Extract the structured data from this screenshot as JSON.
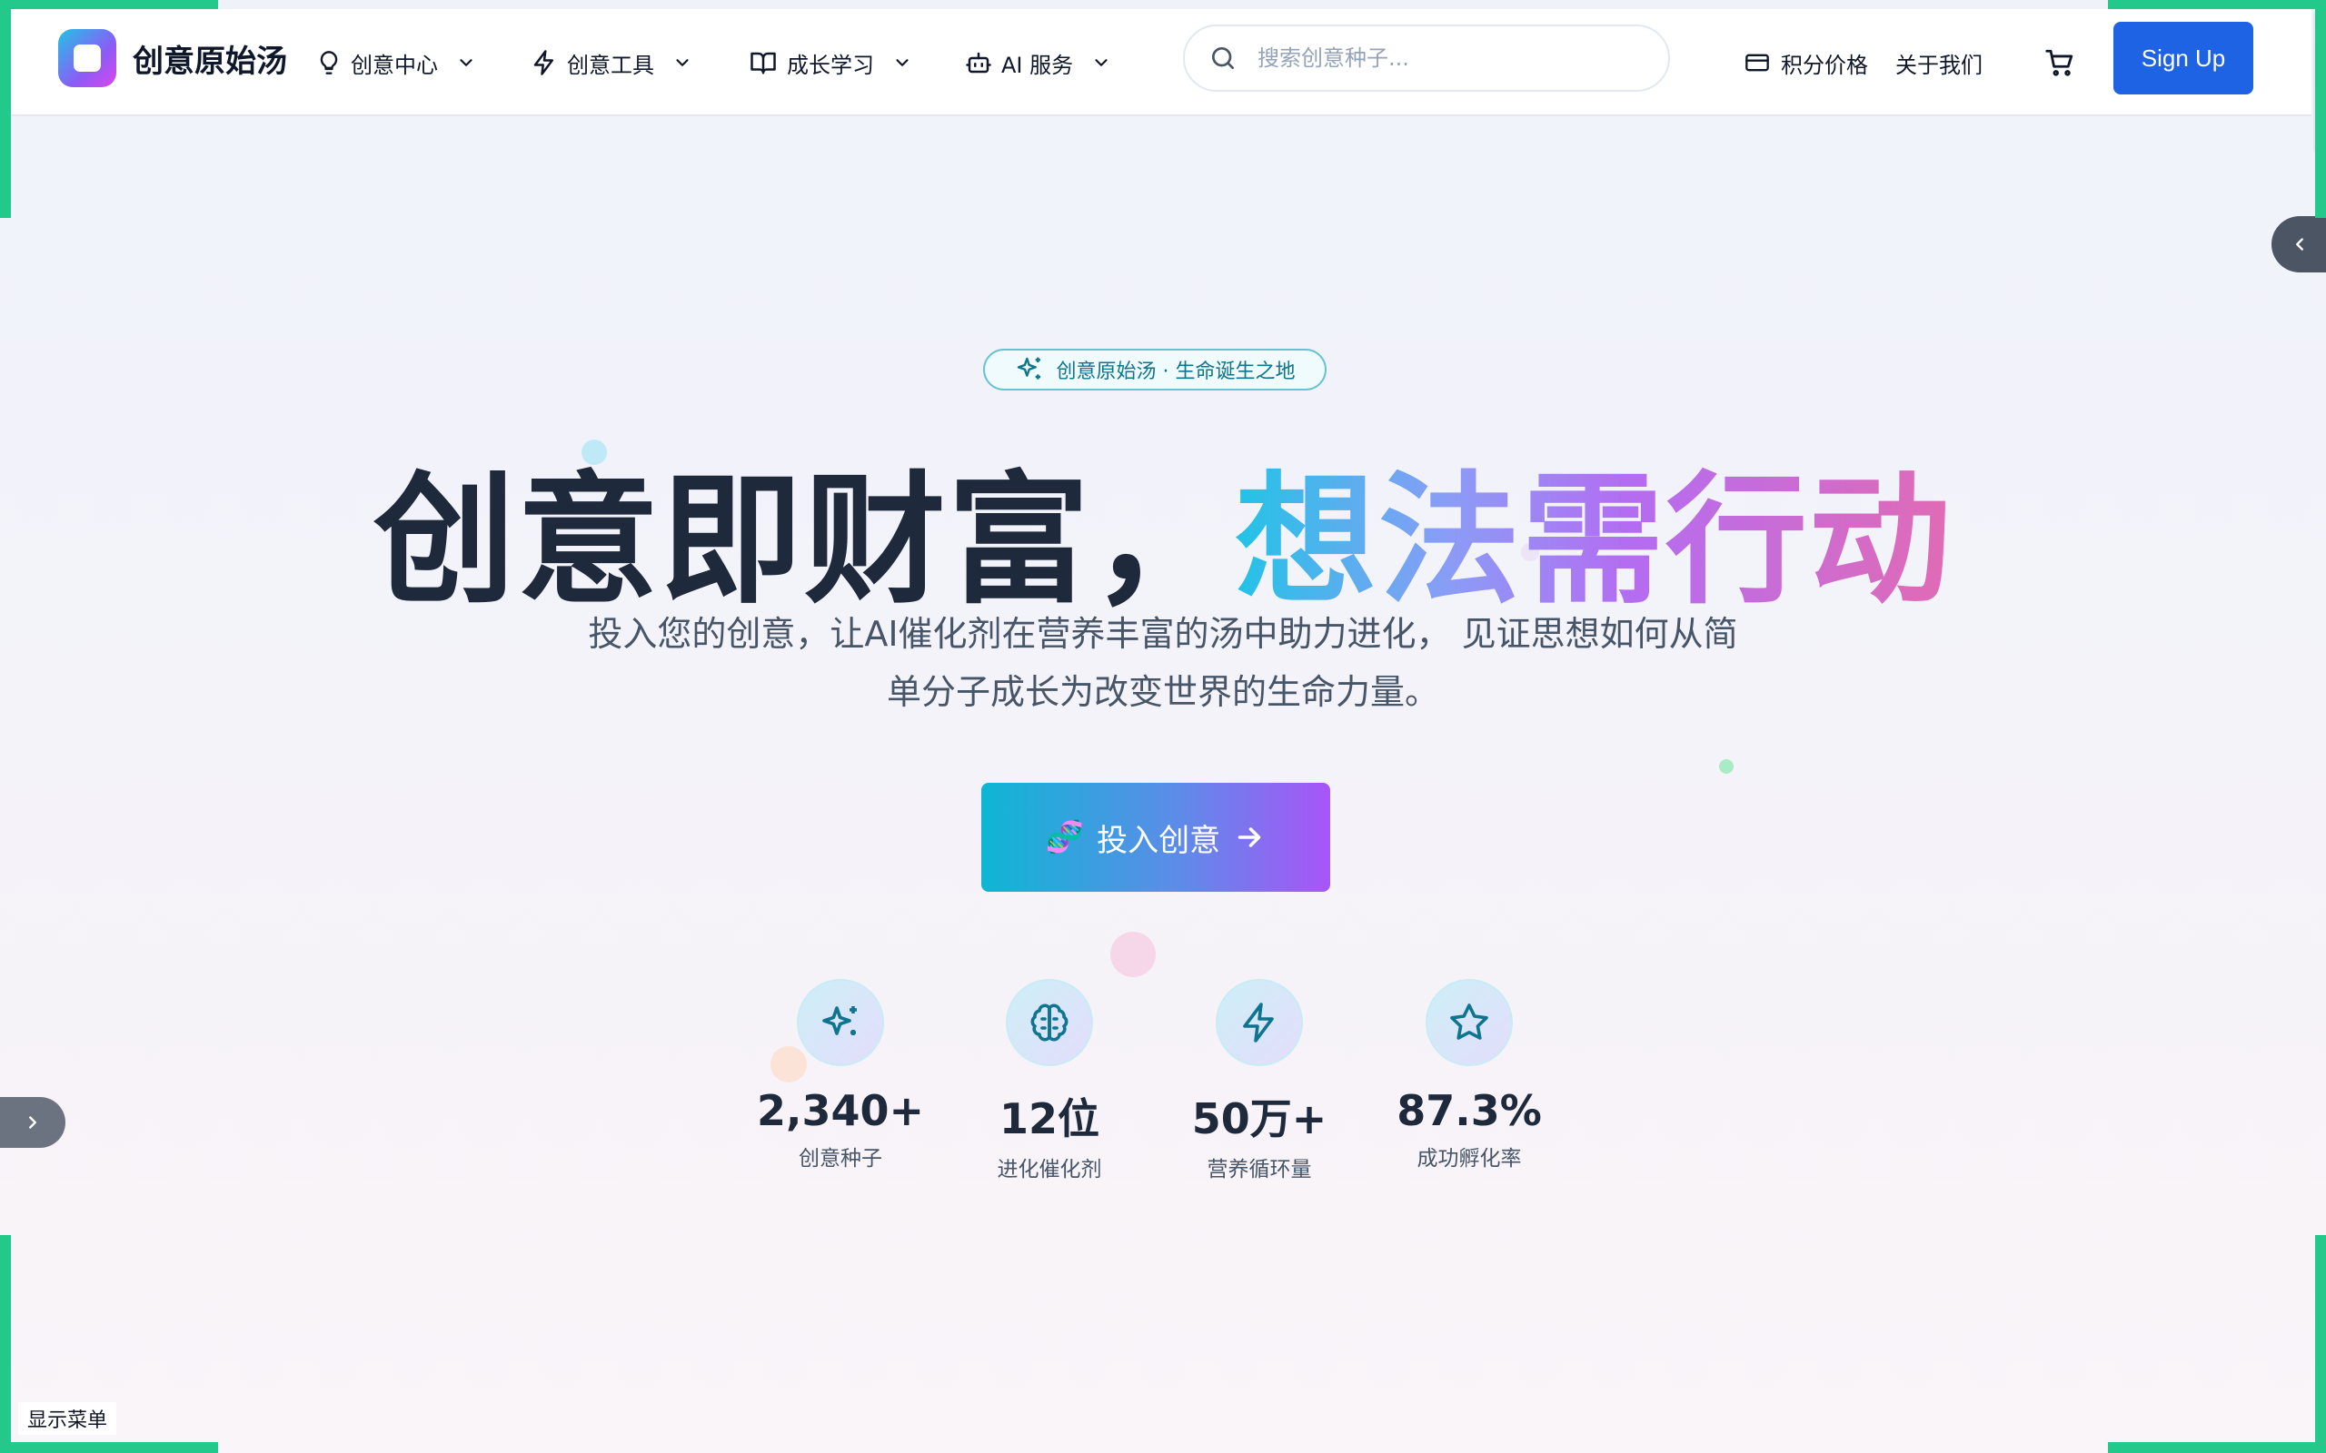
{
  "brand": {
    "name": "创意原始汤"
  },
  "nav": [
    {
      "label": "创意中心",
      "icon": "lightbulb-icon"
    },
    {
      "label": "创意工具",
      "icon": "lightning-icon"
    },
    {
      "label": "成长学习",
      "icon": "book-icon"
    },
    {
      "label": "AI 服务",
      "icon": "robot-icon"
    }
  ],
  "search": {
    "placeholder": "搜索创意种子..."
  },
  "header_links": {
    "pricing": "积分价格",
    "about": "关于我们",
    "signup": "Sign Up"
  },
  "hero": {
    "badge": "创意原始汤 · 生命诞生之地",
    "headline_plain": "创意即财富，",
    "headline_gradient": "想法需行动",
    "subtitle_line1": "投入您的创意，让AI催化剂在营养丰富的汤中助力进化， 见证思想如何从简",
    "subtitle_line2": "单分子成长为改变世界的生命力量。",
    "cta_emoji": "🧬",
    "cta_label": "投入创意"
  },
  "stats": [
    {
      "value": "2,340+",
      "label": "创意种子",
      "icon": "sparkles-icon"
    },
    {
      "value": "12位",
      "label": "进化催化剂",
      "icon": "brain-icon"
    },
    {
      "value": "50万+",
      "label": "营养循环量",
      "icon": "lightning-icon"
    },
    {
      "value": "87.3%",
      "label": "成功孵化率",
      "icon": "star-icon"
    }
  ],
  "show_menu": "显示菜单",
  "colors": {
    "accent": "#1d63e4",
    "teal": "#0e7490",
    "corner": "#22c98a"
  }
}
